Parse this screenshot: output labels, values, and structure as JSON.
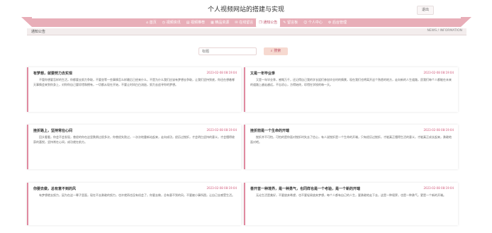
{
  "header": {
    "title": "个人视频网站的搭建与实现",
    "logout_label": "退出"
  },
  "nav": {
    "tabs": [
      {
        "label": "首页",
        "icon": "home-icon"
      },
      {
        "label": "视频资讯",
        "icon": "clock-icon"
      },
      {
        "label": "视频推荐",
        "icon": "news-icon"
      },
      {
        "label": "精品资源",
        "icon": "grid-icon"
      },
      {
        "label": "在线留言",
        "icon": "cart-icon"
      },
      {
        "label": "通知公告",
        "icon": "bookmark-icon",
        "active": true
      },
      {
        "label": "留言板",
        "icon": "chat-icon"
      },
      {
        "label": "个人中心",
        "icon": "user-icon"
      },
      {
        "label": "后台管理",
        "icon": "gear-icon"
      }
    ]
  },
  "breadcrumb": {
    "left": "通知公告",
    "right": "NEWS / INFORMATION"
  },
  "search": {
    "placeholder": "标题",
    "button_label": "搜索"
  },
  "notices": [
    {
      "title": "有梦想，就要努力去实现",
      "date": "2023-02-08 08:19:04",
      "body": "不管你想要怎样的生活，你都要去努力争取，不要坐等一些事情怎么样最后已经来什么，不是为什么我们应该有梦想去争取，让我们坚持到底，你还在想着哪天事情会来到你身上，对你你自己要珍惜和拥有，一切都从现在开始，不要让时间白白流逝，努力去追寻你的梦想。"
    },
    {
      "title": "又是一年毕业季",
      "date": "2023-02-08 08:19:04",
      "body": "又是一年毕业季，感慨万千，还记得自己我的学长姐们参加毕业时的情景，现在我们也将离开这个熟悉的地方，走向新的人生道路，愿我们每个人都能在未来的道路上越走越远，不忘初心，方得始终，珍惜在学校的每一天。"
    },
    {
      "title": "挫折路上，坚持常在心间",
      "date": "2023-02-08 08:19:04",
      "body": "回头看看，你会不会发现，曾经的你在这里跌倒过很多次，你曾经失败过，一次次地重新站起来，走向成功，经历过挫折，才会明白坚持的意义，才会懂得收获的喜悦，坚持常在心间，成功就在前方。"
    },
    {
      "title": "挫折前是一个生命的开端",
      "date": "2023-02-08 08:19:04",
      "body": "挫折并不可怕，可怕的是你面对挫折时失去了信心，有人说挫折是一个生命的开端，只有经历过挫折，才能真正懂得生活的意义，才能真正成长起来，勇敢地面对吧。"
    },
    {
      "title": "你要去做，总有意不到的风",
      "date": "2023-02-08 08:19:04",
      "body": "有梦想就去努力，因为在这一辈子里面，现在不去勇敢的努力，也许就再也没有机会了，你要去做，总有意不到的风，不要被小事所困，让自己去感受生活。"
    },
    {
      "title": "善开首一种境界，是一种勇气，也同样也是一个考验，是一个新的开端",
      "date": "2023-02-08 08:19:04",
      "body": "无论生活是美好，不要放弃希望，也不要轻易放弃梦想，每个人都有自己的人生，要勇敢地走下去，这是一种境界，也是一种勇气，更是一个新的开端。"
    }
  ]
}
